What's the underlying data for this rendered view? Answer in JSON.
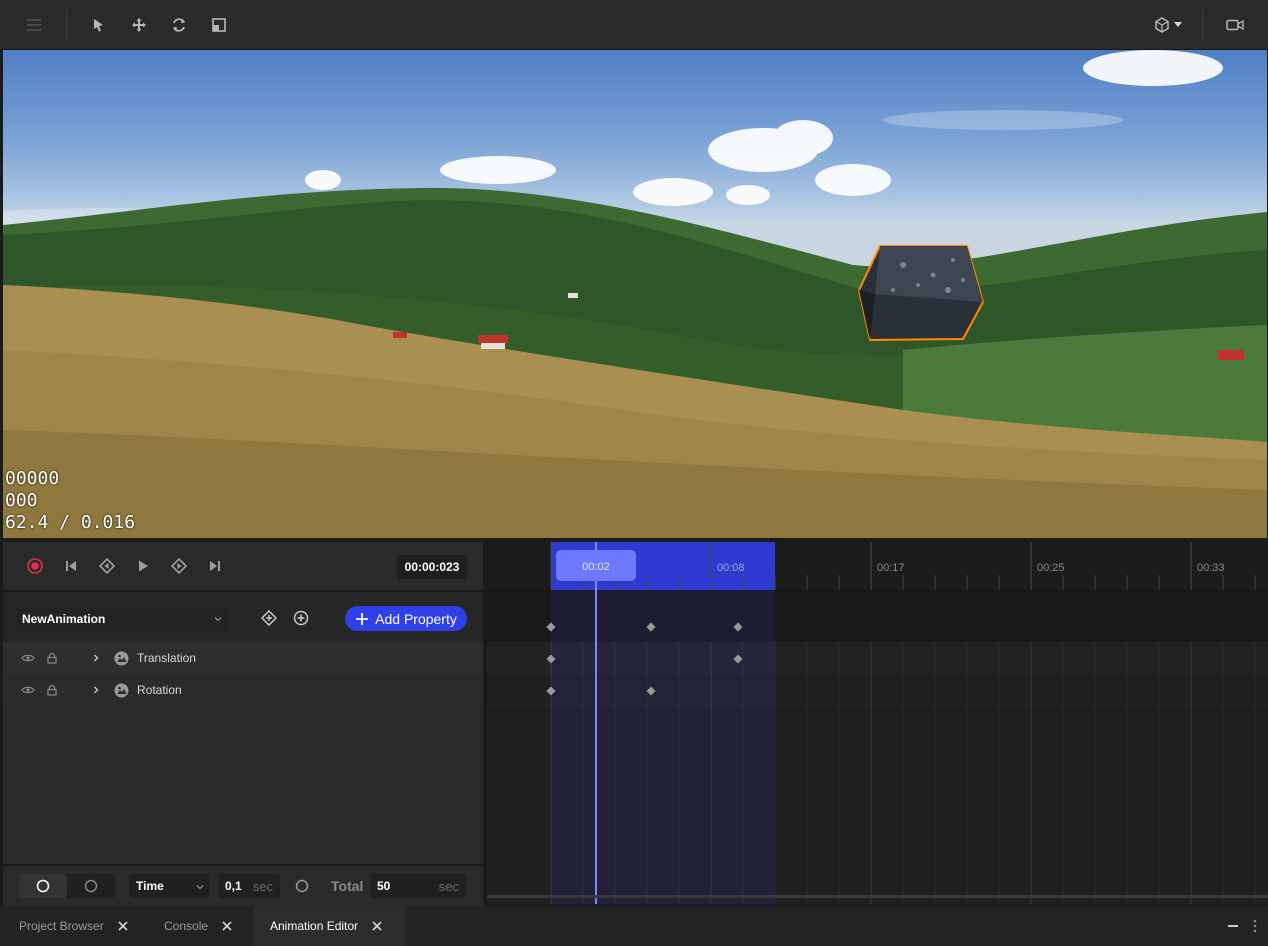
{
  "toolbar": {
    "left_icons": [
      "hamburger-menu-icon",
      "select-arrow-icon",
      "move-icon",
      "rotate-icon",
      "scale-icon"
    ],
    "right_icons": [
      "gizmo-icon",
      "camera-icon"
    ]
  },
  "viewport": {
    "stats": [
      "00000",
      "000",
      "62.4 / 0.016"
    ],
    "selection_outline_color": "#ff8a00"
  },
  "playback": {
    "buttons": [
      "record-icon",
      "skip-start-icon",
      "prev-keyframe-icon",
      "play-icon",
      "next-keyframe-icon",
      "skip-end-icon"
    ],
    "current_time": "00:00:023",
    "record_color": "#e0314e"
  },
  "animation": {
    "name": "NewAnimation",
    "add_property_label": "Add Property",
    "properties": [
      {
        "label": "Translation"
      },
      {
        "label": "Rotation"
      }
    ]
  },
  "controls": {
    "mode_field": "Time",
    "step_value": "0,1",
    "step_unit": "sec",
    "total_label": "Total",
    "total_value": "50",
    "total_unit": "sec"
  },
  "timeline": {
    "playhead_label": "00:02",
    "tick_labels": [
      "00:08",
      "00:17",
      "00:25",
      "00:33"
    ],
    "accent_color": "#2f3ad0",
    "playhead_color": "#7b86ff"
  },
  "dock": {
    "tabs": [
      {
        "label": "Project Browser",
        "active": false
      },
      {
        "label": "Console",
        "active": false
      },
      {
        "label": "Animation Editor",
        "active": true
      }
    ]
  }
}
